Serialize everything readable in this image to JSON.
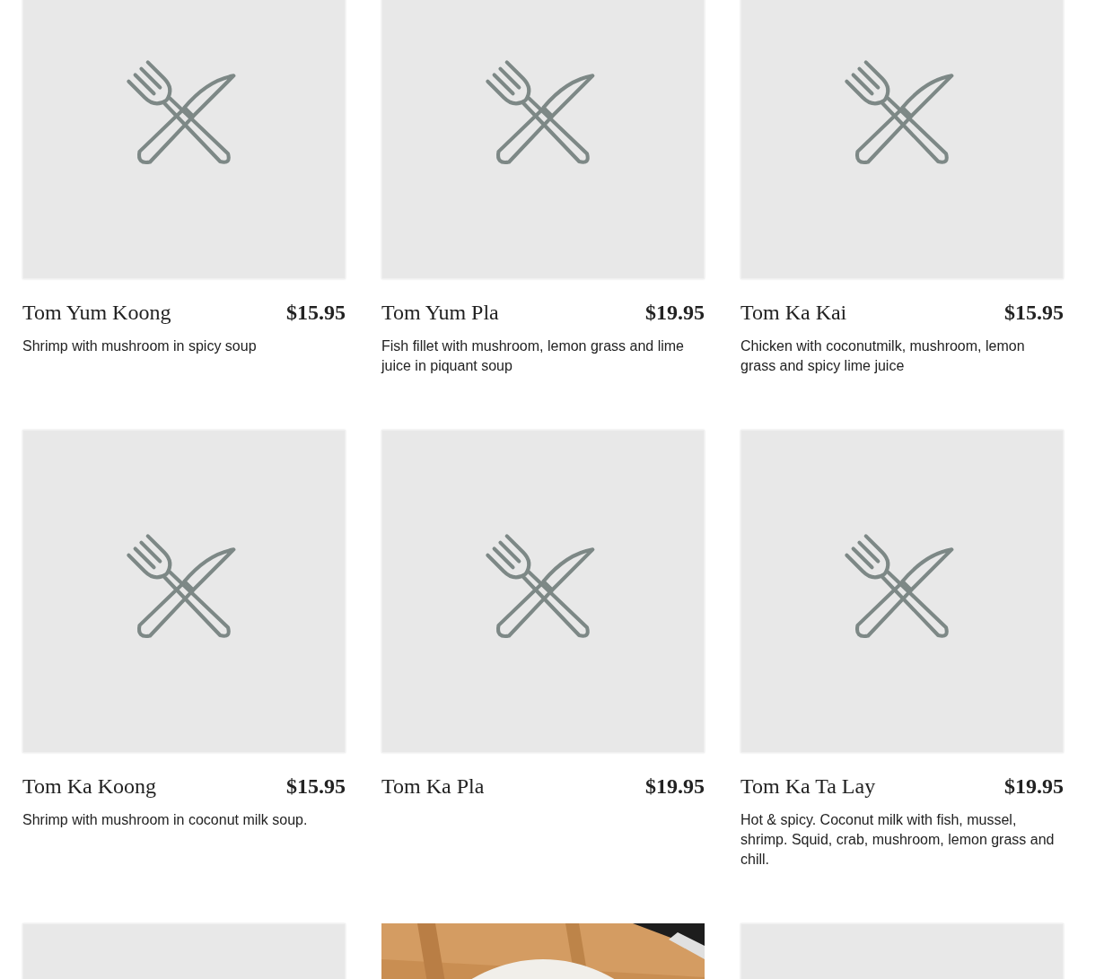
{
  "menu_items": [
    {
      "kind": "placeholder",
      "name": "Tom Yum Koong",
      "price": "$15.95",
      "description": "Shrimp with mushroom in spicy soup"
    },
    {
      "kind": "placeholder",
      "name": "Tom Yum Pla",
      "price": "$19.95",
      "description": "Fish fillet with mushroom, lemon grass and lime juice in piquant soup"
    },
    {
      "kind": "placeholder",
      "name": "Tom Ka Kai",
      "price": "$15.95",
      "description": "Chicken with coconutmilk, mushroom, lemon grass and spicy lime juice"
    },
    {
      "kind": "placeholder",
      "name": "Tom Ka Koong",
      "price": "$15.95",
      "description": "Shrimp with mushroom in coconut milk soup."
    },
    {
      "kind": "placeholder",
      "name": "Tom Ka Pla",
      "price": "$19.95"
    },
    {
      "kind": "placeholder",
      "name": "Tom Ka Ta Lay",
      "price": "$19.95",
      "description": "Hot & spicy. Coconut milk with fish, mussel, shrimp. Squid, crab, mushroom, lemon grass and chill."
    },
    {
      "kind": "placeholder"
    },
    {
      "kind": "picture"
    },
    {
      "kind": "placeholder"
    }
  ]
}
